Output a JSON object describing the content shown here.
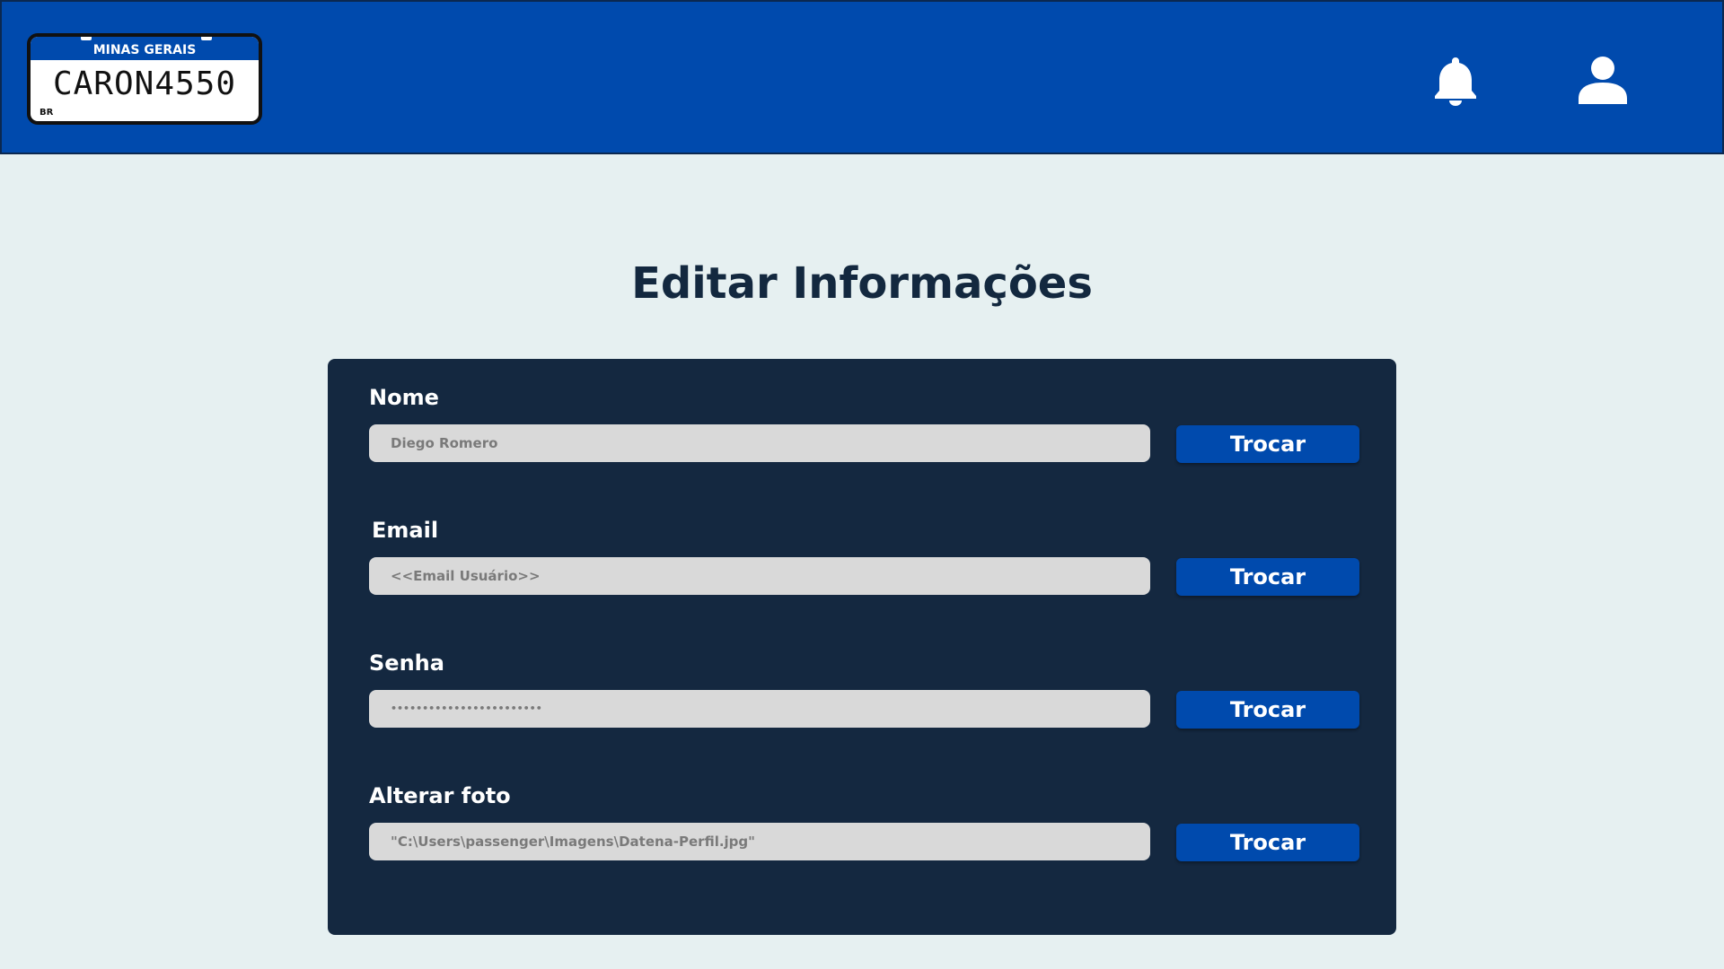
{
  "header": {
    "plate": {
      "state": "MINAS GERAIS",
      "number": "CARON4550",
      "country": "BR"
    },
    "icons": [
      "bell-icon",
      "user-icon"
    ],
    "colors": {
      "bar": "#004aad",
      "icon": "#ffffff"
    }
  },
  "main": {
    "title": "Editar Informações",
    "fields": [
      {
        "label": "Nome",
        "value": "Diego Romero",
        "button": "Trocar"
      },
      {
        "label": "Email",
        "value": "<<Email Usuário>>",
        "button": "Trocar"
      },
      {
        "label": "Senha",
        "value": "••••••••••••••••••••••••",
        "button": "Trocar"
      },
      {
        "label": "Alterar foto",
        "value": "\"C:\\Users\\passenger\\Imagens\\Datena-Perfil.jpg\"",
        "button": "Trocar"
      }
    ],
    "colors": {
      "background": "#e6f0f1",
      "card": "#142840",
      "input": "#d9d9d9",
      "button": "#004aad",
      "title": "#13283f"
    }
  }
}
